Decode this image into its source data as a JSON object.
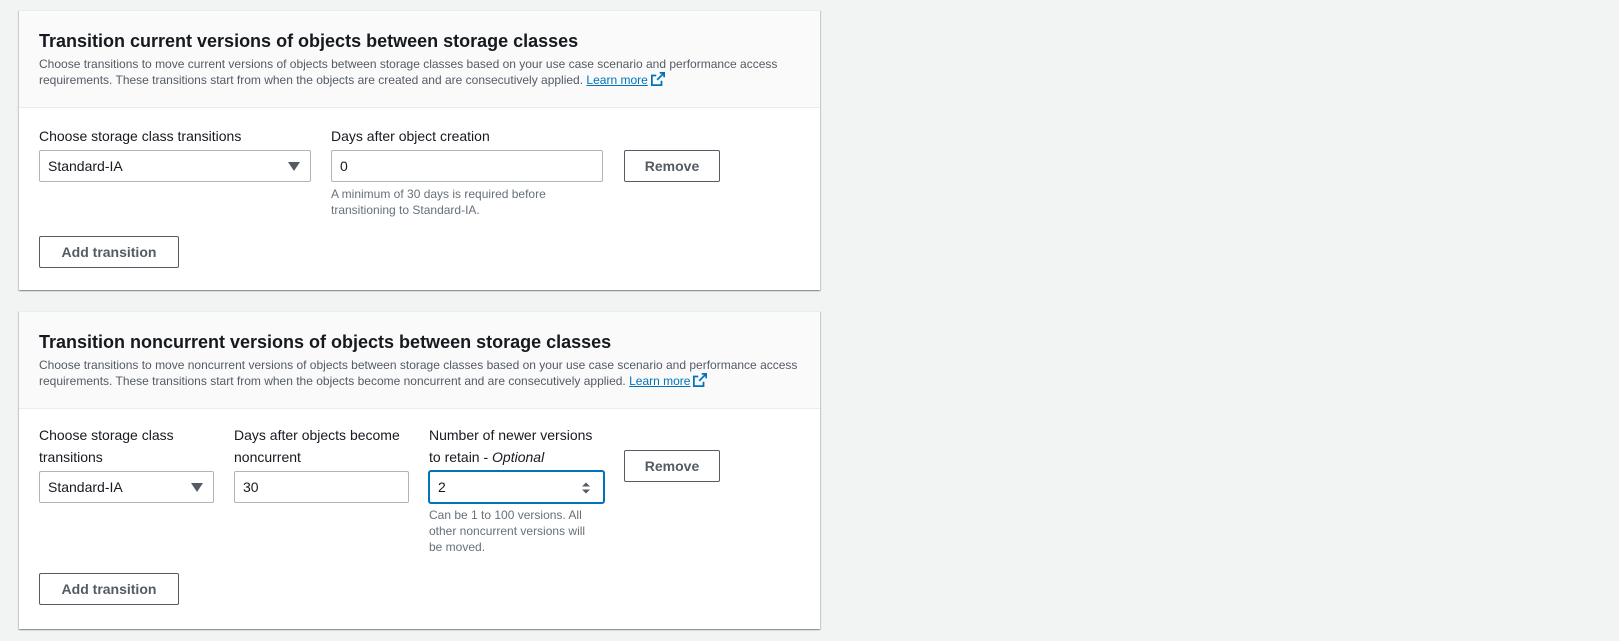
{
  "current_section": {
    "title": "Transition current versions of objects between storage classes",
    "description": "Choose transitions to move current versions of objects between storage classes based on your use case scenario and performance access requirements. These transitions start from when the objects are created and are consecutively applied.",
    "learn_more": "Learn more",
    "storage_class_label": "Choose storage class transitions",
    "storage_class_value": "Standard-IA",
    "days_label": "Days after object creation",
    "days_value": "0",
    "days_hint": "A minimum of 30 days is required before transitioning to Standard-IA.",
    "remove_label": "Remove",
    "add_transition_label": "Add transition"
  },
  "noncurrent_section": {
    "title": "Transition noncurrent versions of objects between storage classes",
    "description": "Choose transitions to move noncurrent versions of objects between storage classes based on your use case scenario and performance access requirements. These transitions start from when the objects become noncurrent and are consecutively applied.",
    "learn_more": "Learn more",
    "storage_class_label": "Choose storage class transitions",
    "storage_class_value": "Standard-IA",
    "days_label": "Days after objects become noncurrent",
    "days_value": "30",
    "versions_label": "Number of newer versions to retain -",
    "versions_optional": "Optional",
    "versions_value": "2",
    "versions_hint": "Can be 1 to 100 versions. All other noncurrent versions will be moved.",
    "remove_label": "Remove",
    "add_transition_label": "Add transition"
  },
  "colors": {
    "link": "#0073bb",
    "focus_border": "#0073bb",
    "button_text": "#545b64",
    "page_bg": "#f2f3f3"
  },
  "icons": {
    "external_link": "external-link-icon",
    "dropdown": "caret-down-icon",
    "spinner": "spinner-icon"
  }
}
